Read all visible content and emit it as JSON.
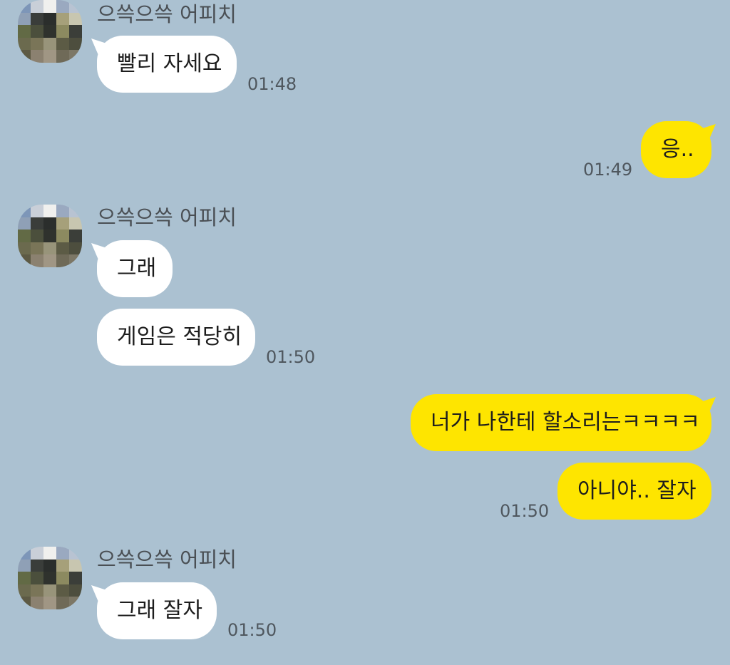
{
  "colors": {
    "background": "#abc1d1",
    "incoming_bubble": "#ffffff",
    "outgoing_bubble": "#fee500",
    "timestamp": "#4f575e",
    "sender_name": "#4a4f54"
  },
  "groups": [
    {
      "sender": "으쓱으쓱 어피치",
      "messages": [
        "빨리 자세요"
      ],
      "time": "01:48"
    },
    {
      "direction": "outgoing",
      "messages": [
        "응.."
      ],
      "time": "01:49"
    },
    {
      "sender": "으쓱으쓱 어피치",
      "messages": [
        "그래",
        "게임은 적당히"
      ],
      "time": "01:50"
    },
    {
      "direction": "outgoing",
      "messages": [
        "너가 나한테 할소리는ㅋㅋㅋㅋ",
        "아니야.. 잘자"
      ],
      "time": "01:50"
    },
    {
      "sender": "으쓱으쓱 어피치",
      "messages": [
        "그래 잘자"
      ],
      "time": "01:50"
    }
  ]
}
